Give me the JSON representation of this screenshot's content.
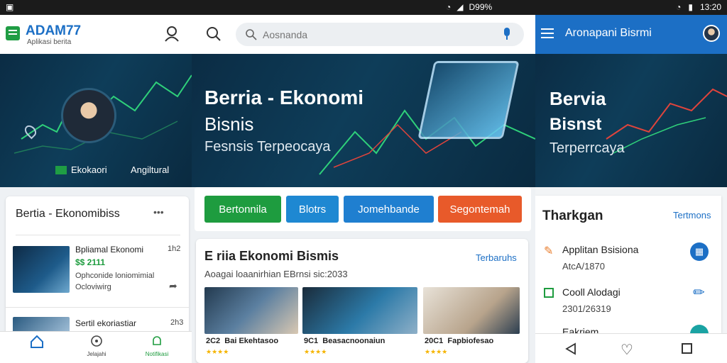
{
  "status": {
    "left_icon": "notification-icon",
    "mid_text": "D99%",
    "time": "13:20"
  },
  "left_app": {
    "brand": "ADAM77",
    "brand_sub": "Aplikasi berita",
    "hero_labels": [
      "Ekokaori",
      "Angiltural"
    ],
    "news_card": {
      "title": "Bertia - Ekonomibiss",
      "menu": "•••",
      "items": [
        {
          "title": "Bpliamal Ekonomi",
          "price": "$$ 2111",
          "desc": "Ophconide loniomimial",
          "sub": "Ocloviwirg",
          "time": "1h2"
        },
        {
          "title": "Sertil ekoriastiar",
          "time": "2h3"
        }
      ]
    },
    "bottom_nav": [
      "Beranda",
      "Jelajahi",
      "Notifikasi"
    ]
  },
  "mid_app": {
    "search_placeholder": "Aosnanda",
    "hero": {
      "title": "Berria - Ekonomi",
      "subtitle": "Bisnis",
      "tagline": "Fesnsis Terpeocaya"
    },
    "buttons": [
      {
        "label": "Bertonnila",
        "color": "#1e9c3f"
      },
      {
        "label": "Blotrs",
        "color": "#1e88d2"
      },
      {
        "label": "Jomehbande",
        "color": "#1f7fd0"
      },
      {
        "label": "Segontemah",
        "color": "#e85a2a"
      }
    ],
    "section": {
      "title": "E  riia Ekonomi Bismis",
      "more": "Terbaruhs",
      "subtitle": "Aoagai loaanirhian EBrnsi sic:2033",
      "cards": [
        {
          "title": "2C2 ⁠ Bai Ekehtasoo"
        },
        {
          "title": "9C1 ⁠ Beasacnoonaiun"
        },
        {
          "title": "20C1 ⁠ Fapbiofesao"
        }
      ]
    }
  },
  "right_app": {
    "header_title": "Aronapani Bisrmi",
    "hero": {
      "title": "Bervia",
      "subtitle": "Bisnst",
      "tagline": "Terperrcaya"
    },
    "card": {
      "title": "Tharkgan",
      "more": "Tertmons",
      "items": [
        {
          "title": "Applitan Bsisiona",
          "sub": "AtcA/1870"
        },
        {
          "title": "Cooll Alodagi",
          "sub": "2301/26319"
        },
        {
          "title": "Eakriem"
        }
      ]
    }
  }
}
